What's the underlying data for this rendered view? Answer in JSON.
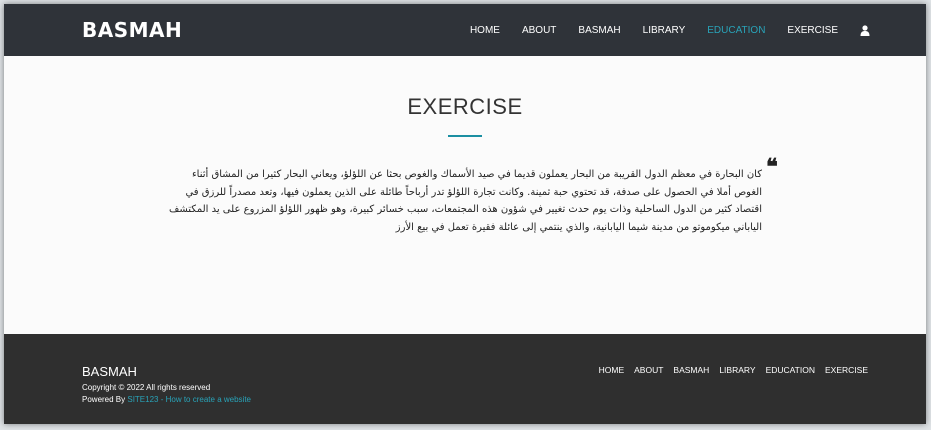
{
  "header": {
    "brand": "BASMAH",
    "nav": [
      {
        "label": "HOME",
        "active": false
      },
      {
        "label": "ABOUT",
        "active": false
      },
      {
        "label": "BASMAH",
        "active": false
      },
      {
        "label": "LIBRARY",
        "active": false
      },
      {
        "label": "EDUCATION",
        "active": true
      },
      {
        "label": "EXERCISE",
        "active": false
      }
    ],
    "user_icon": "user-icon",
    "active_color": "#29a3b8"
  },
  "main": {
    "title": "EXERCISE",
    "quote_icon": "quote-icon",
    "paragraph": "كان البحارة في معظم الدول القريبة من البحار يعملون قديما في صيد الأسماك والغوص بحثا عن اللؤلؤ، ويعاني البحار كثيرا من المشاق أثناء الغوص أملا في الحصول على صدفة، قد تحتوي حبة ثمينة. وكانت تجارة اللؤلؤ تدر أرباحاً طائلة على الذين يعملون فيها، وتعد مصدراً للرزق في اقتصاد كثير من الدول الساحلية وذات يوم حدث تغيير في شؤون هذه المجتمعات، سبب خسائر كبيرة، وهو ظهور اللؤلؤ المزروع على يد المكتشف الياباني ميكوموتو من مدينة شيما اليابانية، والذي ينتمي إلى عائلة فقيرة تعمل في بيع الأرز"
  },
  "footer": {
    "brand": "BASMAH",
    "copyright": "Copyright © 2022 All rights reserved",
    "powered_prefix": "Powered By ",
    "powered_link": "SITE123",
    "powered_sep": " - ",
    "powered_link2": "How to create a website",
    "nav": [
      "HOME",
      "ABOUT",
      "BASMAH",
      "LIBRARY",
      "EDUCATION",
      "EXERCISE"
    ]
  }
}
